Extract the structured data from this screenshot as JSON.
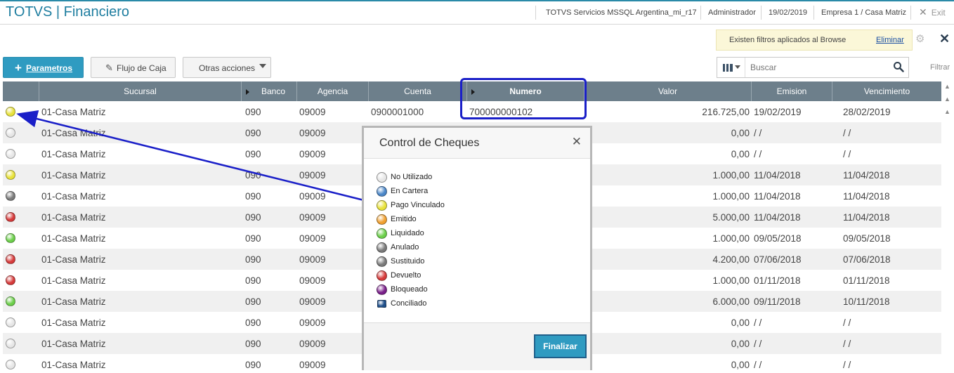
{
  "header": {
    "app_title": "TOTVS | Financiero",
    "environment": "TOTVS Servicios MSSQL Argentina_mi_r17",
    "user": "Administrador",
    "date": "19/02/2019",
    "company": "Empresa 1 / Casa Matriz",
    "exit_label": "Exit"
  },
  "filter_banner": {
    "text": "Existen filtros aplicados al Browse",
    "link": "Eliminar"
  },
  "toolbar": {
    "parametros_label": "Parametros",
    "flujo_label": "Flujo de Caja",
    "otras_label": "Otras acciones",
    "search_placeholder": "Buscar",
    "filtrar_label": "Filtrar"
  },
  "grid": {
    "columns": [
      "Sucursal",
      "Banco",
      "Agencia",
      "Cuenta",
      "Numero",
      "Valor",
      "Emision",
      "Vencimiento"
    ],
    "rows": [
      {
        "status": "yellow",
        "sucursal": "01-Casa Matriz",
        "banco": "090",
        "agencia": "09009",
        "cuenta": "0900001000",
        "numero": "700000000102",
        "valor": "216.725,00",
        "emision": "19/02/2019",
        "vencimiento": "28/02/2019"
      },
      {
        "status": "white",
        "sucursal": "01-Casa Matriz",
        "banco": "090",
        "agencia": "09009",
        "cuenta": "",
        "numero": "",
        "valor": "0,00",
        "emision": "/ /",
        "vencimiento": "/ /"
      },
      {
        "status": "white",
        "sucursal": "01-Casa Matriz",
        "banco": "090",
        "agencia": "09009",
        "cuenta": "",
        "numero": "",
        "valor": "0,00",
        "emision": "/ /",
        "vencimiento": "/ /"
      },
      {
        "status": "yellow",
        "sucursal": "01-Casa Matriz",
        "banco": "090",
        "agencia": "09009",
        "cuenta": "",
        "numero": "",
        "valor": "1.000,00",
        "emision": "11/04/2018",
        "vencimiento": "11/04/2018"
      },
      {
        "status": "gray",
        "sucursal": "01-Casa Matriz",
        "banco": "090",
        "agencia": "09009",
        "cuenta": "",
        "numero": "",
        "valor": "1.000,00",
        "emision": "11/04/2018",
        "vencimiento": "11/04/2018"
      },
      {
        "status": "red",
        "sucursal": "01-Casa Matriz",
        "banco": "090",
        "agencia": "09009",
        "cuenta": "",
        "numero": "",
        "valor": "5.000,00",
        "emision": "11/04/2018",
        "vencimiento": "11/04/2018"
      },
      {
        "status": "green",
        "sucursal": "01-Casa Matriz",
        "banco": "090",
        "agencia": "09009",
        "cuenta": "",
        "numero": "",
        "valor": "1.000,00",
        "emision": "09/05/2018",
        "vencimiento": "09/05/2018"
      },
      {
        "status": "red",
        "sucursal": "01-Casa Matriz",
        "banco": "090",
        "agencia": "09009",
        "cuenta": "",
        "numero": "",
        "valor": "4.200,00",
        "emision": "07/06/2018",
        "vencimiento": "07/06/2018"
      },
      {
        "status": "red",
        "sucursal": "01-Casa Matriz",
        "banco": "090",
        "agencia": "09009",
        "cuenta": "",
        "numero": "",
        "valor": "1.000,00",
        "emision": "01/11/2018",
        "vencimiento": "01/11/2018"
      },
      {
        "status": "green",
        "sucursal": "01-Casa Matriz",
        "banco": "090",
        "agencia": "09009",
        "cuenta": "",
        "numero": "",
        "valor": "6.000,00",
        "emision": "09/11/2018",
        "vencimiento": "10/11/2018"
      },
      {
        "status": "white",
        "sucursal": "01-Casa Matriz",
        "banco": "090",
        "agencia": "09009",
        "cuenta": "",
        "numero": "",
        "valor": "0,00",
        "emision": "/ /",
        "vencimiento": "/ /"
      },
      {
        "status": "white",
        "sucursal": "01-Casa Matriz",
        "banco": "090",
        "agencia": "09009",
        "cuenta": "",
        "numero": "",
        "valor": "0,00",
        "emision": "/ /",
        "vencimiento": "/ /"
      },
      {
        "status": "white",
        "sucursal": "01-Casa Matriz",
        "banco": "090",
        "agencia": "09009",
        "cuenta": "",
        "numero": "",
        "valor": "0,00",
        "emision": "/ /",
        "vencimiento": "/ /"
      }
    ]
  },
  "status_colors": {
    "white": "#e6e6e6",
    "blue": "#4a86c8",
    "yellow": "#e8e23a",
    "orange": "#f0a030",
    "green": "#6ccf4a",
    "gray": "#7a7a7a",
    "red": "#d63a3a",
    "purple": "#7a1f8a",
    "navy": "#1f4f8a"
  },
  "modal": {
    "title": "Control de Cheques",
    "legend": [
      {
        "label": "No Utilizado",
        "color": "white"
      },
      {
        "label": "En Cartera",
        "color": "blue"
      },
      {
        "label": "Pago Vinculado",
        "color": "yellow"
      },
      {
        "label": "Emitido",
        "color": "orange"
      },
      {
        "label": "Liquidado",
        "color": "green"
      },
      {
        "label": "Anulado",
        "color": "gray"
      },
      {
        "label": "Sustituido",
        "color": "gray"
      },
      {
        "label": "Devuelto",
        "color": "red"
      },
      {
        "label": "Bloqueado",
        "color": "purple"
      },
      {
        "label": "Conciliado",
        "color": "navy"
      }
    ],
    "finalizar_label": "Finalizar"
  }
}
